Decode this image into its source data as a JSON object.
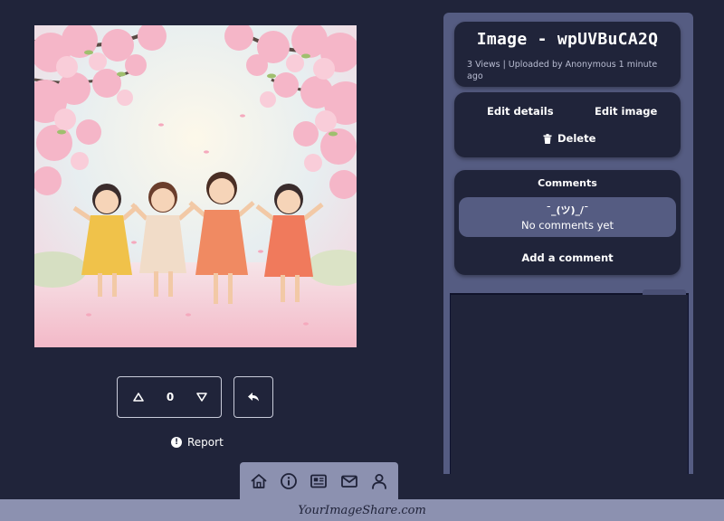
{
  "image": {
    "title": "Image - wpUVBuCA2Q",
    "meta": "3 Views | Uploaded by Anonymous 1 minute ago",
    "icon": "uploaded-photo-cherry-blossom-girls"
  },
  "votes": {
    "count": "0",
    "upvote_icon": "triangle-up-icon",
    "downvote_icon": "triangle-down-icon",
    "share_icon": "share-arrow-icon"
  },
  "report": {
    "label": "Report",
    "icon": "exclamation-circle-icon"
  },
  "actions": {
    "edit_details": "Edit details",
    "edit_image": "Edit image",
    "delete": "Delete",
    "delete_icon": "trash-icon"
  },
  "comments": {
    "title": "Comments",
    "empty_face": "¯_(ツ)_/¯",
    "empty_text": "No comments yet",
    "add_label": "Add a comment"
  },
  "nav": {
    "items": [
      "home-icon",
      "info-icon",
      "newspaper-icon",
      "mail-icon",
      "user-icon"
    ]
  },
  "footer": {
    "brand": "YourImageShare.com"
  },
  "colors": {
    "background": "#20243a",
    "panel": "#555c82",
    "card": "#20243a",
    "nav": "#8c91b0"
  }
}
